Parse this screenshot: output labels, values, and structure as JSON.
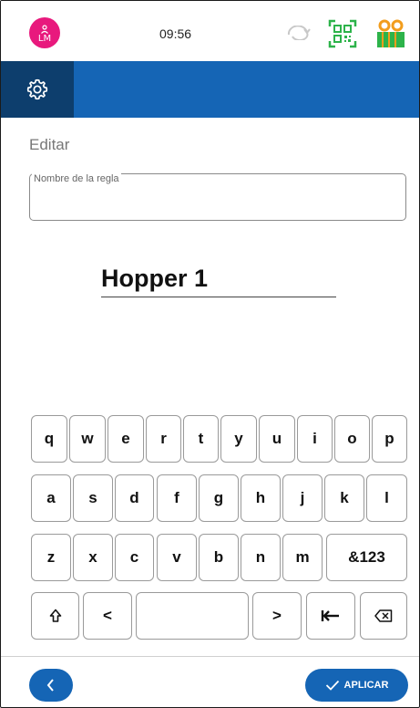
{
  "status_bar": {
    "avatar_initials": "LM",
    "time": "09:56",
    "avatar_color": "#e8197d",
    "accent_green": "#2db34a"
  },
  "toolbar": {
    "color": "#1565b5",
    "settings_icon": "gear-icon"
  },
  "editor": {
    "heading": "Editar",
    "field_label": "Nombre de la regla",
    "field_value": "",
    "name_display": "Hopper 1"
  },
  "keyboard": {
    "row1": [
      "q",
      "w",
      "e",
      "r",
      "t",
      "y",
      "u",
      "i",
      "o",
      "p"
    ],
    "row2": [
      "a",
      "s",
      "d",
      "f",
      "g",
      "h",
      "j",
      "k",
      "l"
    ],
    "row3": [
      "z",
      "x",
      "c",
      "v",
      "b",
      "n",
      "m",
      "&123"
    ],
    "row4": [
      "shift-icon",
      "<",
      "space",
      ">",
      "tab-icon",
      "backspace-icon"
    ],
    "left_label": "<",
    "right_label": ">",
    "space_label": ""
  },
  "footer": {
    "back_icon": "chevron-left-icon",
    "apply_label": "APLICAR",
    "apply_icon": "check-icon"
  }
}
